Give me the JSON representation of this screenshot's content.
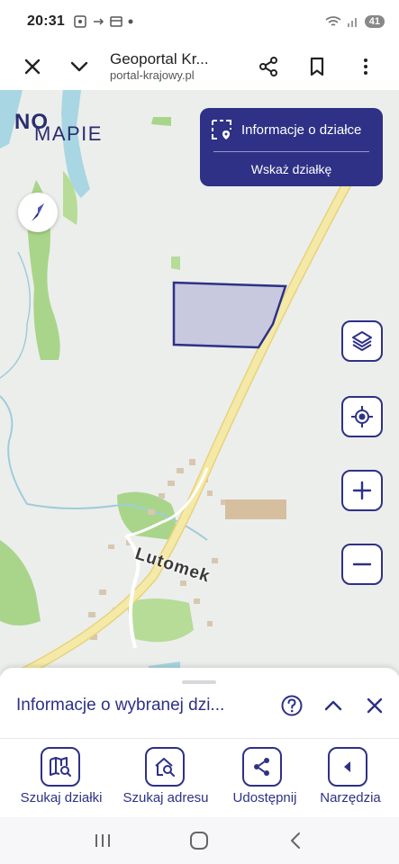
{
  "status_bar": {
    "time": "20:31",
    "battery": "41"
  },
  "browser": {
    "title": "Geoportal Kr...",
    "url": "portal-krajowy.pl",
    "close_icon": "close-icon",
    "expand_icon": "chevron-down-icon",
    "share_icon": "share-icon",
    "bookmark_icon": "bookmark-icon",
    "more_icon": "more-vertical-icon"
  },
  "map": {
    "logo_no": "NO",
    "logo_mapie": "MAPIE",
    "place_label": "Lutomek",
    "parcel_panel": {
      "info_label": "Informacje o działce",
      "point_label": "Wskaż działkę"
    },
    "controls": [
      "layers-icon",
      "locate-icon",
      "zoom-in-icon",
      "zoom-out-icon"
    ],
    "colors": {
      "accent": "#2e3186",
      "road": "#f2e49a",
      "forest": "#a9d58a",
      "water": "#9fd0df",
      "parcel_fill": "#c8c9df"
    }
  },
  "sheet": {
    "title": "Informacje o wybranej dzi...",
    "tools": [
      {
        "label": "Szukaj działki",
        "icon": "map-search-icon"
      },
      {
        "label": "Szukaj adresu",
        "icon": "home-search-icon"
      },
      {
        "label": "Udostępnij",
        "icon": "share-icon"
      },
      {
        "label": "Narzędzia",
        "icon": "tools-icon"
      }
    ]
  }
}
